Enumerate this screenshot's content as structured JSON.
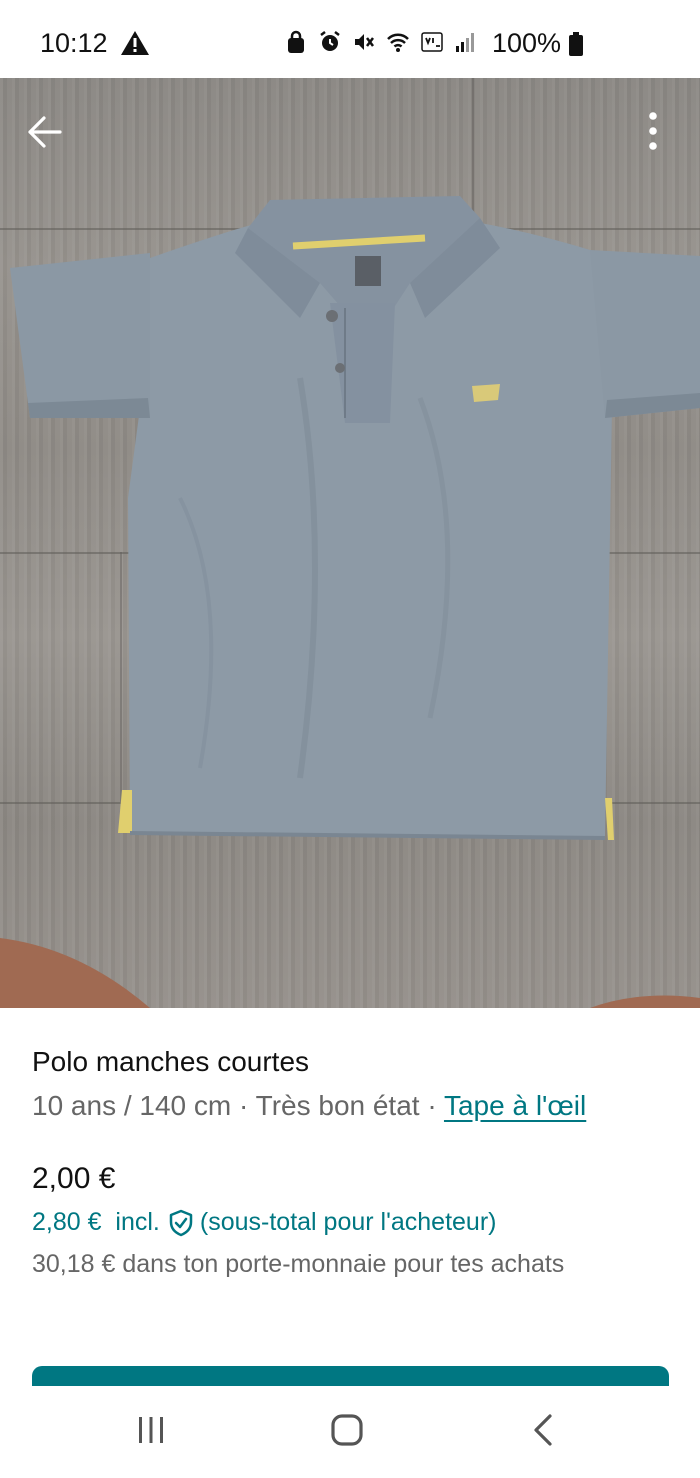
{
  "status_bar": {
    "time": "10:12",
    "battery": "100%"
  },
  "product": {
    "title": "Polo manches courtes",
    "size": "10 ans / 140 cm",
    "separator": " · ",
    "condition": "Très bon état",
    "brand": "Tape à l'œil",
    "price": "2,00 €",
    "price_incl": "2,80 €",
    "incl_label": "incl.",
    "subtotal_note": "(sous-total pour l'acheteur)",
    "wallet_note": "30,18 € dans ton porte-monnaie pour tes achats"
  },
  "carousel": {
    "count": 5,
    "active_index": 0
  },
  "colors": {
    "accent": "#007782",
    "text_secondary": "#666666"
  },
  "icons": [
    "back-arrow-icon",
    "more-vertical-icon",
    "shield-check-icon",
    "warning-icon",
    "battery-icon"
  ]
}
